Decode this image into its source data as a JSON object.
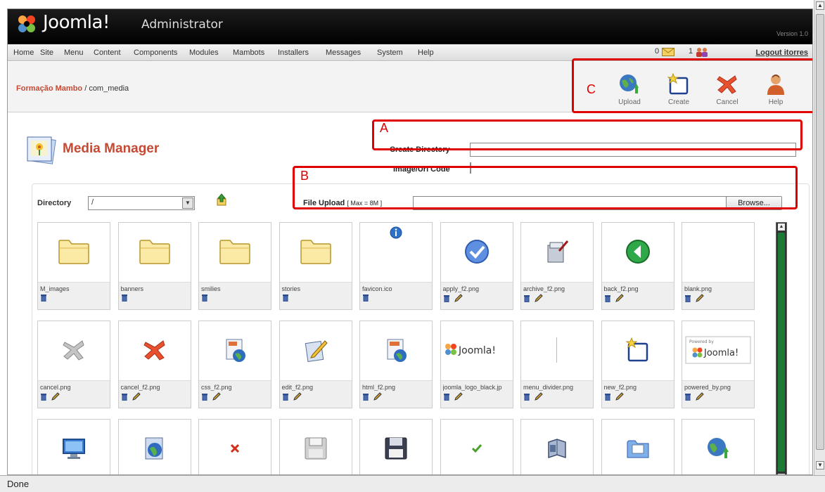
{
  "header": {
    "logo_text": "Joomla!",
    "product_text": "Administrator",
    "version_text": "Version 1.0"
  },
  "menu": {
    "items": [
      "Home",
      "Site",
      "Menu",
      "Content",
      "Components",
      "Modules",
      "Mambots",
      "Installers",
      "Messages",
      "System",
      "Help"
    ],
    "messages_count": "0",
    "users_count": "1",
    "logout": "Logout itorres"
  },
  "breadcrumb": {
    "site": "Formação Mambo",
    "separator": " / ",
    "component": "com_media"
  },
  "toolbar": {
    "upload": "Upload",
    "create": "Create",
    "cancel": "Cancel",
    "help": "Help"
  },
  "annotations": {
    "a": "A",
    "b": "B",
    "c": "C"
  },
  "page": {
    "title": "Media Manager"
  },
  "form": {
    "create_directory_label": "Create Directory",
    "create_directory_value": "",
    "image_url_code_label": "Image/Url Code",
    "file_upload_label": "File Upload",
    "file_upload_hint": "[ Max = 8M ]",
    "file_upload_value": "",
    "browse_button": "Browse...",
    "directory_label": "Directory",
    "directory_value": "/"
  },
  "files": [
    {
      "name": "M_images",
      "icon": "folder-icon",
      "deletable": true,
      "editable": false
    },
    {
      "name": "banners",
      "icon": "folder-icon",
      "deletable": true,
      "editable": false
    },
    {
      "name": "smilies",
      "icon": "folder-icon",
      "deletable": true,
      "editable": false
    },
    {
      "name": "stories",
      "icon": "folder-icon",
      "deletable": true,
      "editable": false
    },
    {
      "name": "favicon.ico",
      "icon": "info-icon",
      "deletable": true,
      "editable": false
    },
    {
      "name": "apply_f2.png",
      "icon": "checkmark-icon",
      "deletable": true,
      "editable": true
    },
    {
      "name": "archive_f2.png",
      "icon": "archive-icon",
      "deletable": true,
      "editable": true
    },
    {
      "name": "back_f2.png",
      "icon": "back-icon",
      "deletable": true,
      "editable": true
    },
    {
      "name": "blank.png",
      "icon": "blank-icon",
      "deletable": true,
      "editable": true
    },
    {
      "name": "cancel.png",
      "icon": "cancel-gray-icon",
      "deletable": true,
      "editable": true
    },
    {
      "name": "cancel_f2.png",
      "icon": "cancel-red-icon",
      "deletable": true,
      "editable": true
    },
    {
      "name": "css_f2.png",
      "icon": "css-doc-icon",
      "deletable": true,
      "editable": true
    },
    {
      "name": "edit_f2.png",
      "icon": "edit-icon",
      "deletable": true,
      "editable": true
    },
    {
      "name": "html_f2.png",
      "icon": "html-doc-icon",
      "deletable": true,
      "editable": true
    },
    {
      "name": "joomla_logo_black.jp",
      "icon": "joomla-logo-icon",
      "deletable": true,
      "editable": true
    },
    {
      "name": "menu_divider.png",
      "icon": "divider-icon",
      "deletable": true,
      "editable": true
    },
    {
      "name": "new_f2.png",
      "icon": "new-icon",
      "deletable": true,
      "editable": true
    },
    {
      "name": "powered_by.png",
      "icon": "powered-by-icon",
      "deletable": true,
      "editable": true
    },
    {
      "name": "",
      "icon": "monitor-icon",
      "deletable": false,
      "editable": false
    },
    {
      "name": "",
      "icon": "globe-doc-icon",
      "deletable": false,
      "editable": false
    },
    {
      "name": "",
      "icon": "small-x-icon",
      "deletable": false,
      "editable": false
    },
    {
      "name": "",
      "icon": "floppy-gray-icon",
      "deletable": false,
      "editable": false
    },
    {
      "name": "",
      "icon": "floppy-dark-icon",
      "deletable": false,
      "editable": false
    },
    {
      "name": "",
      "icon": "small-check-icon",
      "deletable": false,
      "editable": false
    },
    {
      "name": "",
      "icon": "book-icon",
      "deletable": false,
      "editable": false
    },
    {
      "name": "",
      "icon": "folder-doc-icon",
      "deletable": false,
      "editable": false
    },
    {
      "name": "",
      "icon": "globe-upload-icon",
      "deletable": false,
      "editable": false
    }
  ],
  "labels": {
    "powered_by_small": "Powered by",
    "joomla_small": "Joomla!"
  },
  "status": {
    "text": "Done"
  },
  "colors": {
    "annotation": "#e00000",
    "brand_red": "#c64934",
    "scroll_green": "#1d7a34"
  }
}
